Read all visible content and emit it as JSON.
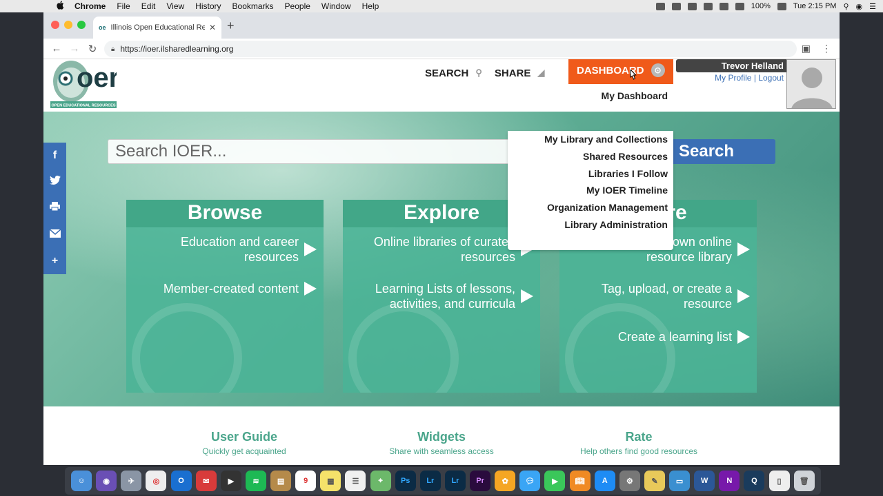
{
  "menubar": {
    "app": "Chrome",
    "items": [
      "File",
      "Edit",
      "View",
      "History",
      "Bookmarks",
      "People",
      "Window",
      "Help"
    ],
    "battery": "100%",
    "clock": "Tue 2:15 PM"
  },
  "browser": {
    "tab_title": "Illinois Open Educational Resou",
    "url": "https://ioer.ilsharedlearning.org"
  },
  "site": {
    "logo_text": "oer",
    "logo_tagline": "OPEN EDUCATIONAL RESOURCES",
    "nav": {
      "search": "SEARCH",
      "share": "SHARE",
      "dashboard": "DASHBOARD"
    },
    "user": {
      "name": "Trevor Helland",
      "profile": "My Profile",
      "separator": "|",
      "logout": "Logout"
    },
    "dashboard_menu": [
      "My Dashboard",
      "My Library and Collections",
      "Shared Resources",
      "Libraries I Follow",
      "My IOER Timeline",
      "Organization Management",
      "Library Administration"
    ],
    "search": {
      "placeholder": "Search IOER...",
      "button": "Search"
    },
    "social": [
      "f",
      "t",
      "print",
      "mail",
      "+"
    ],
    "cards": [
      {
        "title": "Browse",
        "items": [
          "Education and career resources",
          "Member-created content"
        ]
      },
      {
        "title": "Explore",
        "items": [
          "Online libraries of curated resources",
          "Learning Lists of lessons, activities, and curricula"
        ]
      },
      {
        "title": "Share",
        "items": [
          "Open your own online resource library",
          "Tag, upload, or create a resource",
          "Create a learning list"
        ]
      }
    ],
    "footer": [
      {
        "title": "User Guide",
        "subtitle": "Quickly get acquainted"
      },
      {
        "title": "Widgets",
        "subtitle": "Share with seamless access"
      },
      {
        "title": "Rate",
        "subtitle": "Help others find good resources"
      }
    ]
  },
  "dock": {
    "labels": [
      "Ps",
      "Lr",
      "Lr",
      "Pr",
      "W",
      "N"
    ]
  },
  "colors": {
    "accent_orange": "#f05a1a",
    "accent_blue": "#3b6fb5",
    "teal": "#4aa58b"
  }
}
